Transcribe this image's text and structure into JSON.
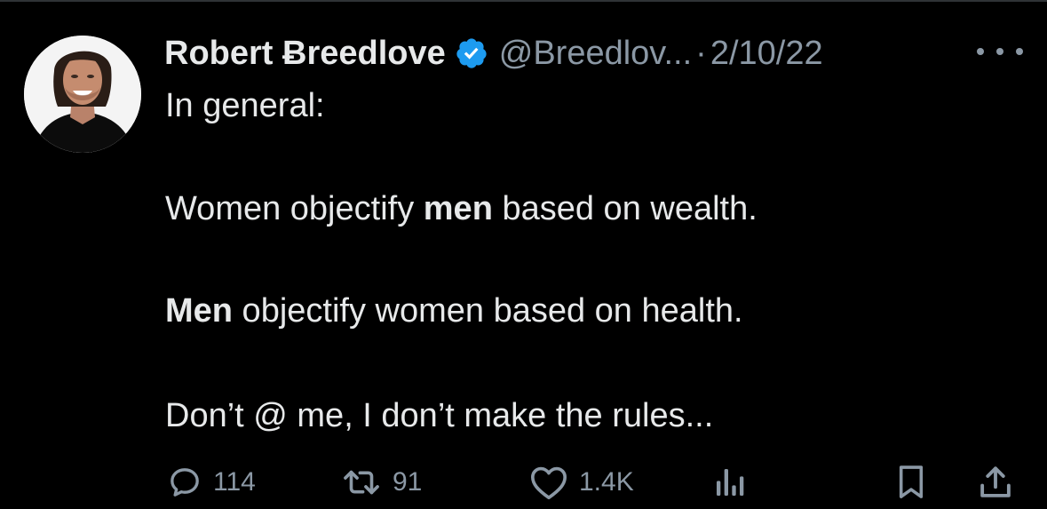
{
  "tweet": {
    "author": {
      "display_name": "Robert Ƀreedlove",
      "handle": "@Breedlov...",
      "verified_icon": "verified-badge-icon",
      "avatar_icon": "avatar-photo"
    },
    "separator": "·",
    "date": "2/10/22",
    "more_icon": "more-horizontal-icon",
    "lines": {
      "intro": "In general:",
      "line1_bold": "Women objectify ",
      "line1_emph": "men",
      "line1_rest": " based on wealth.",
      "line2_emph": "Men",
      "line2_rest": " objectify women based on health.",
      "line3": "Don’t @ me, I don’t make the rules..."
    },
    "actions": {
      "replies": "114",
      "retweets": "91",
      "likes": "1.4K",
      "reply_icon": "reply-icon",
      "retweet_icon": "retweet-icon",
      "like_icon": "heart-icon",
      "views_icon": "views-icon",
      "bookmark_icon": "bookmark-icon",
      "share_icon": "share-icon"
    }
  },
  "colors": {
    "background": "#000000",
    "text_primary": "#e7e9ea",
    "text_secondary": "#8b98a5",
    "verified_blue": "#1d9bf0"
  }
}
